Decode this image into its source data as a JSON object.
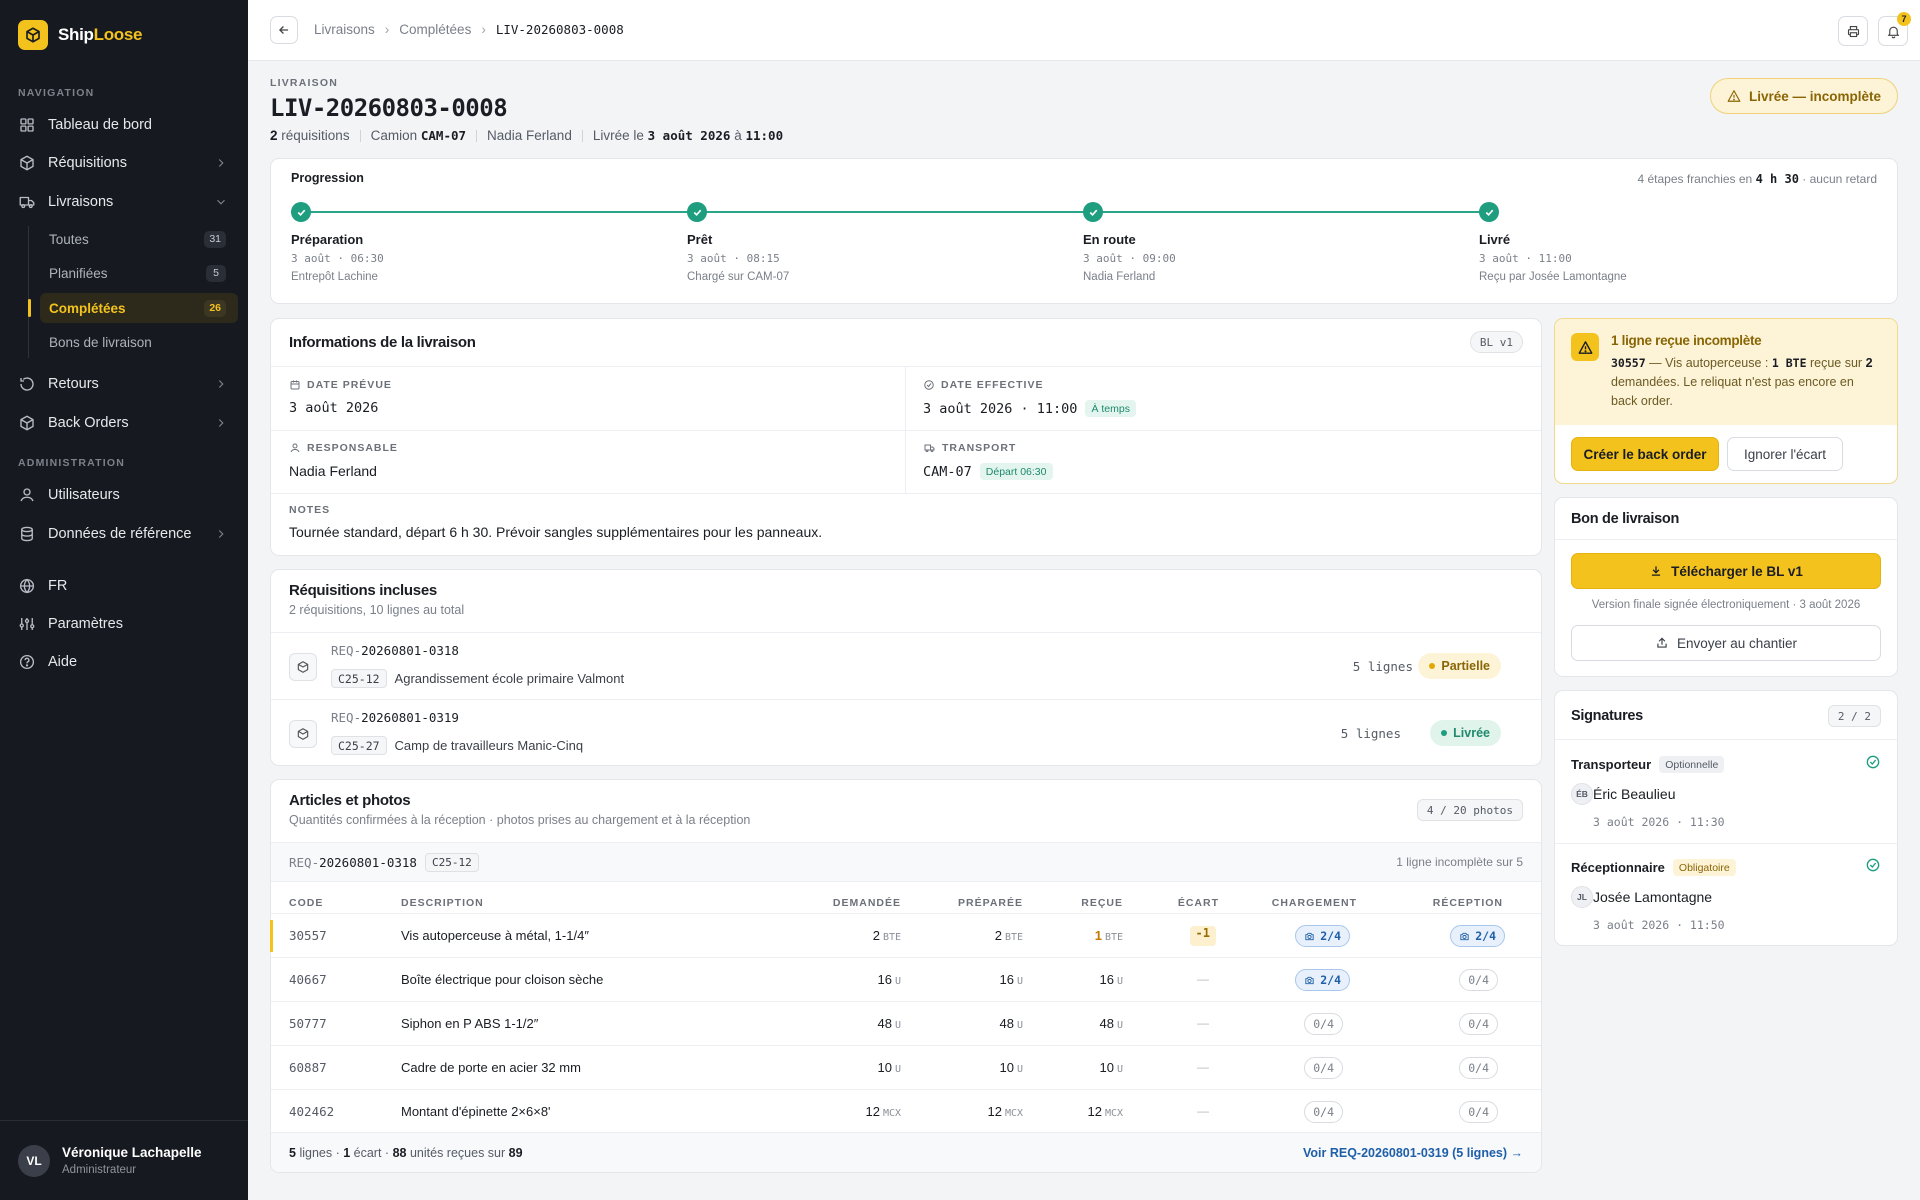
{
  "brand": {
    "name_part1": "Ship",
    "name_part2": "Loose"
  },
  "sidebar": {
    "section_nav": "NAVIGATION",
    "dashboard": "Tableau de bord",
    "requisitions": "Réquisitions",
    "deliveries": "Livraisons",
    "sub": [
      {
        "label": "Toutes",
        "count": "31"
      },
      {
        "label": "Planifiées",
        "count": "5"
      },
      {
        "label": "Complétées",
        "count": "26"
      },
      {
        "label": "Bons de livraison",
        "count": ""
      }
    ],
    "returns": "Retours",
    "back_orders": "Back Orders",
    "section_admin": "ADMINISTRATION",
    "users": "Utilisateurs",
    "reference_data": "Données de référence",
    "language": "FR",
    "settings": "Paramètres",
    "help": "Aide",
    "user": {
      "initials": "VL",
      "name": "Véronique Lachapelle",
      "role": "Administrateur"
    }
  },
  "topbar": {
    "crumbs": [
      "Livraisons",
      "Complétées",
      "LIV-20260803-0008"
    ],
    "separator": "›",
    "notif_count": "7"
  },
  "header": {
    "eyebrow": "LIVRAISON",
    "title": "LIV-20260803-0008",
    "req_count": "2",
    "req_label": "réquisitions",
    "truck_label": "Camion",
    "truck": "CAM-07",
    "driver": "Nadia Ferland",
    "delivered_label": "Livrée le",
    "delivered_date": "3 août 2026",
    "at": "à",
    "delivered_time": "11:00",
    "status": "Livrée — incomplète"
  },
  "progress": {
    "title": "Progression",
    "note_pre": "4 étapes franchies en",
    "note_duration": "4 h 30",
    "note_post": "· aucun retard",
    "steps": [
      {
        "name": "Préparation",
        "time": "3 août · 06:30",
        "sub": "Entrepôt Lachine"
      },
      {
        "name": "Prêt",
        "time": "3 août · 08:15",
        "sub": "Chargé sur CAM-07"
      },
      {
        "name": "En route",
        "time": "3 août · 09:00",
        "sub": "Nadia Ferland"
      },
      {
        "name": "Livré",
        "time": "3 août · 11:00",
        "sub": "Reçu par Josée Lamontagne"
      }
    ]
  },
  "info": {
    "title": "Informations de la livraison",
    "version": "BL v1",
    "planned_label": "DATE PRÉVUE",
    "planned_value": "3 août 2026",
    "effective_label": "DATE EFFECTIVE",
    "effective_value": "3 août 2026 · 11:00",
    "effective_chip": "À temps",
    "owner_label": "RESPONSABLE",
    "owner_value": "Nadia Ferland",
    "transport_label": "TRANSPORT",
    "transport_value": "CAM-07",
    "transport_chip": "Départ 06:30",
    "notes_label": "NOTES",
    "notes_value": "Tournée standard, départ 6 h 30. Prévoir sangles supplémentaires pour les panneaux."
  },
  "requisitions": {
    "title": "Réquisitions incluses",
    "subtitle": "2 réquisitions, 10 lignes au total",
    "items": [
      {
        "prefix": "REQ-",
        "code": "20260801-0318",
        "project": "C25-12",
        "name": "Agrandissement école primaire Valmont",
        "lines": "5 lignes",
        "status": "Partielle"
      },
      {
        "prefix": "REQ-",
        "code": "20260801-0319",
        "project": "C25-27",
        "name": "Camp de travailleurs Manic-Cinq",
        "lines": "5 lignes",
        "status": "Livrée"
      }
    ]
  },
  "articles": {
    "title": "Articles et photos",
    "subtitle": "Quantités confirmées à la réception · photos prises au chargement et à la réception",
    "photos": "4 / 20 photos",
    "group_prefix": "REQ-",
    "group_code": "20260801-0318",
    "group_project": "C25-12",
    "group_note": "1 ligne incomplète sur 5",
    "columns": [
      "CODE",
      "DESCRIPTION",
      "DEMANDÉE",
      "PRÉPARÉE",
      "REÇUE",
      "ÉCART",
      "CHARGEMENT",
      "RÉCEPTION"
    ],
    "rows": [
      {
        "code": "30557",
        "desc": "Vis autoperceuse à métal, 1-1/4″",
        "dem": "2",
        "prep": "2",
        "recu": "1",
        "unit": "BTE",
        "ecart": "-1",
        "charg": "2/4",
        "recep": "2/4",
        "charg_on": true,
        "recep_on": true
      },
      {
        "code": "40667",
        "desc": "Boîte électrique pour cloison sèche",
        "dem": "16",
        "prep": "16",
        "recu": "16",
        "unit": "U",
        "ecart": "—",
        "charg": "2/4",
        "recep": "0/4",
        "charg_on": true,
        "recep_on": false
      },
      {
        "code": "50777",
        "desc": "Siphon en P ABS 1-1/2″",
        "dem": "48",
        "prep": "48",
        "recu": "48",
        "unit": "U",
        "ecart": "—",
        "charg": "0/4",
        "recep": "0/4",
        "charg_on": false,
        "recep_on": false
      },
      {
        "code": "60887",
        "desc": "Cadre de porte en acier 32 mm",
        "dem": "10",
        "prep": "10",
        "recu": "10",
        "unit": "U",
        "ecart": "—",
        "charg": "0/4",
        "recep": "0/4",
        "charg_on": false,
        "recep_on": false
      },
      {
        "code": "402462",
        "desc": "Montant d'épinette 2×6×8'",
        "dem": "12",
        "prep": "12",
        "recu": "12",
        "unit": "MCX",
        "ecart": "—",
        "charg": "0/4",
        "recep": "0/4",
        "charg_on": false,
        "recep_on": false
      }
    ],
    "footer": {
      "lines": "5",
      "lines_label": "lignes ·",
      "gaps": "1",
      "gaps_label": "écart ·",
      "received": "88",
      "received_label": "unités reçues sur",
      "total": "89",
      "link": "Voir REQ-20260801-0319 (5 lignes) →"
    }
  },
  "alert": {
    "title": "1 ligne reçue incomplète",
    "code": "30557",
    "text1": "— Vis autoperceuse :",
    "qty": "1 BTE",
    "text2": "reçue sur",
    "qty2": "2",
    "text3": "demandées. Le reliquat n'est pas encore en back order.",
    "create": "Créer le back order",
    "ignore": "Ignorer l'écart"
  },
  "bl": {
    "title": "Bon de livraison",
    "download": "Télécharger le BL v1",
    "note": "Version finale signée électroniquement · 3 août 2026",
    "send": "Envoyer au chantier"
  },
  "signatures": {
    "title": "Signatures",
    "count": "2 / 2",
    "items": [
      {
        "role": "Transporteur",
        "chip": "Optionnelle",
        "initials": "ÉB",
        "name": "Éric Beaulieu",
        "time": "3 août 2026 · 11:30"
      },
      {
        "role": "Réceptionnaire",
        "chip": "Obligatoire",
        "initials": "JL",
        "name": "Josée Lamontagne",
        "time": "3 août 2026 · 11:50"
      }
    ]
  },
  "colors": {
    "accent": "#f4c21d",
    "success": "#1f9d7f",
    "warning_bg": "#fdf4d8",
    "sidebar_bg": "#16191f"
  }
}
